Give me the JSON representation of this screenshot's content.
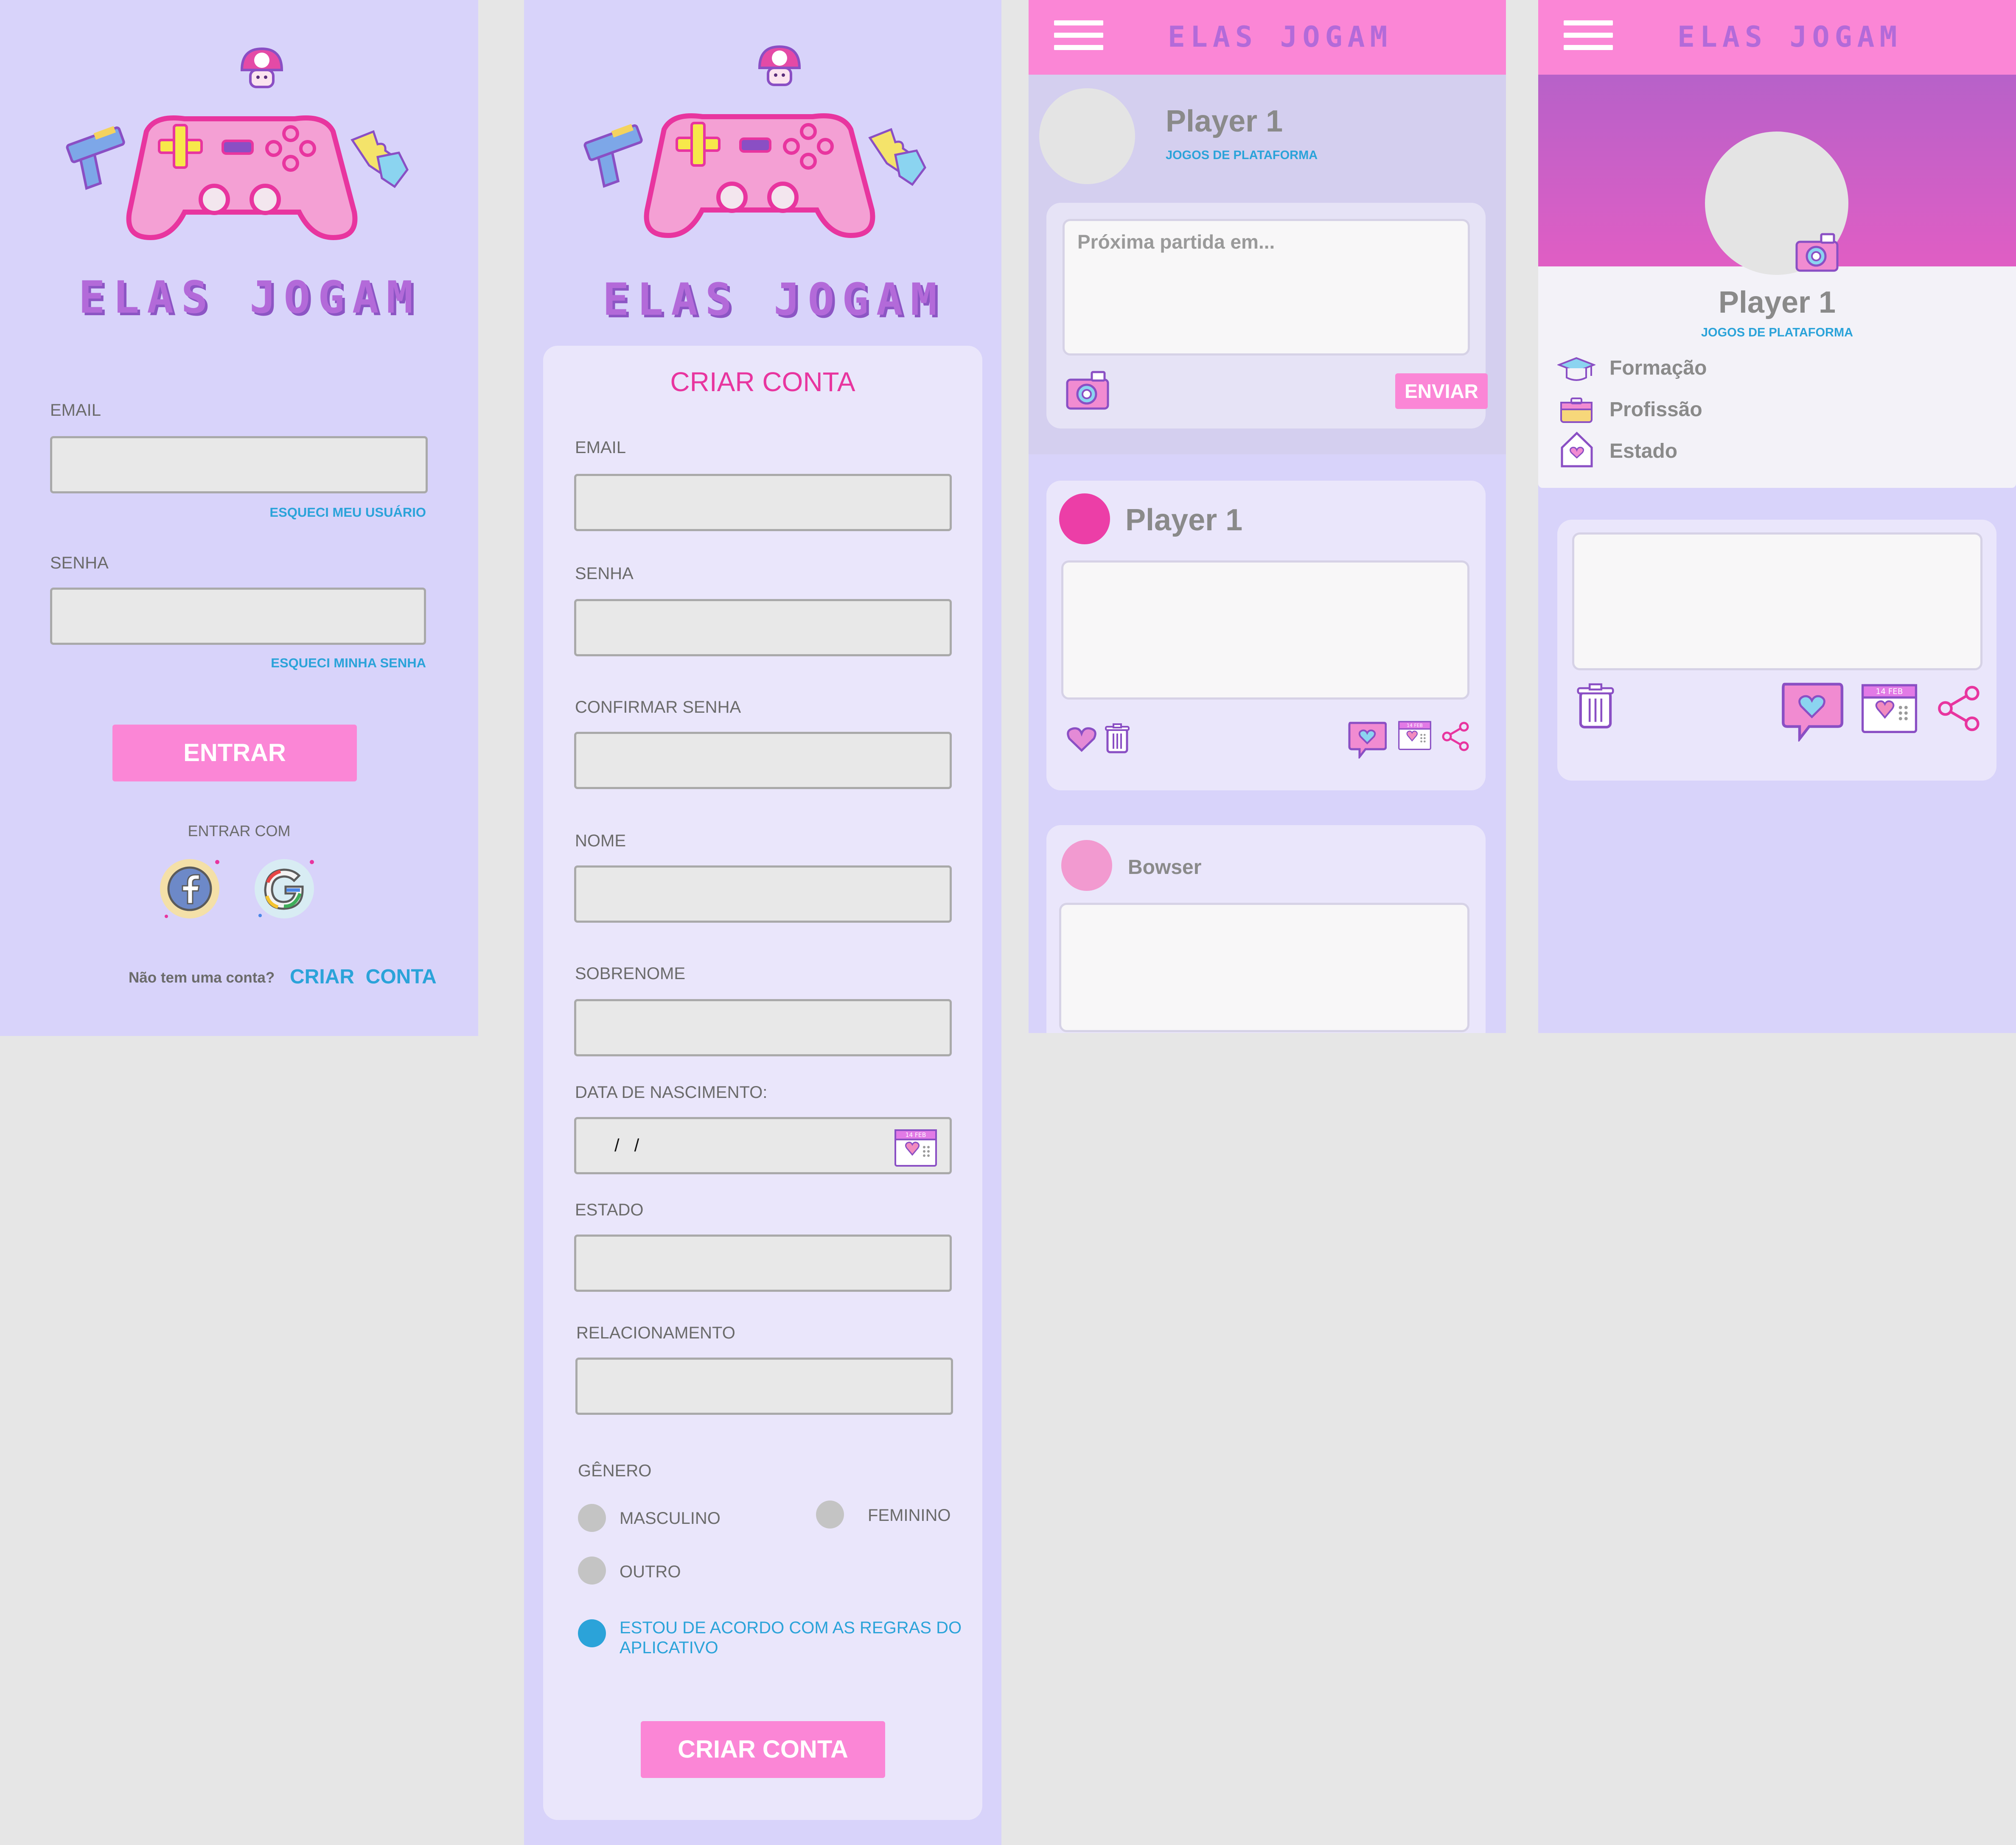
{
  "brand": {
    "name": "ELAS JOGAM"
  },
  "login": {
    "email_label": "EMAIL",
    "forgot_user": "ESQUECI MEU USUÁRIO",
    "password_label": "SENHA",
    "forgot_password": "ESQUECI MINHA SENHA",
    "enter_button": "ENTRAR",
    "enter_with": "ENTRAR COM",
    "no_account": "Não tem uma conta?",
    "create_account": "CRIAR  CONTA"
  },
  "signup": {
    "title": "CRIAR CONTA",
    "email_label": "EMAIL",
    "password_label": "SENHA",
    "confirm_password_label": "CONFIRMAR SENHA",
    "name_label": "NOME",
    "surname_label": "SOBRENOME",
    "birthdate_label": "DATA DE NASCIMENTO:",
    "birthdate_value": "/   /",
    "state_label": "ESTADO",
    "relationship_label": "RELACIONAMENTO",
    "gender_label": "GÊNERO",
    "gender_options": [
      "MASCULINO",
      "FEMININO",
      "OUTRO"
    ],
    "terms_line1": "ESTOU DE ACORDO COM AS REGRAS DO",
    "terms_line2": "APLICATIVO",
    "submit_button": "CRIAR CONTA"
  },
  "feed": {
    "profile_name": "Player 1",
    "profile_subtitle": "JOGOS DE PLATAFORMA",
    "post_placeholder": "Próxima partida em...",
    "send_button": "ENVIAR",
    "posts": [
      {
        "author": "Player 1"
      },
      {
        "author": "Bowser"
      }
    ]
  },
  "profile": {
    "name": "Player 1",
    "subtitle": "JOGOS DE PLATAFORMA",
    "info": [
      "Formação",
      "Profissão",
      "Estado"
    ]
  },
  "calendar_icon_text": "14 FEB",
  "colors": {
    "background": "#e6e6e6",
    "screen_bg": "#d8d3fa",
    "card_bg": "#eae6fb",
    "pink": "#fb86d6",
    "purple": "#b36ad9",
    "link_blue": "#2ba3d9",
    "title_pink": "#e8359f"
  }
}
